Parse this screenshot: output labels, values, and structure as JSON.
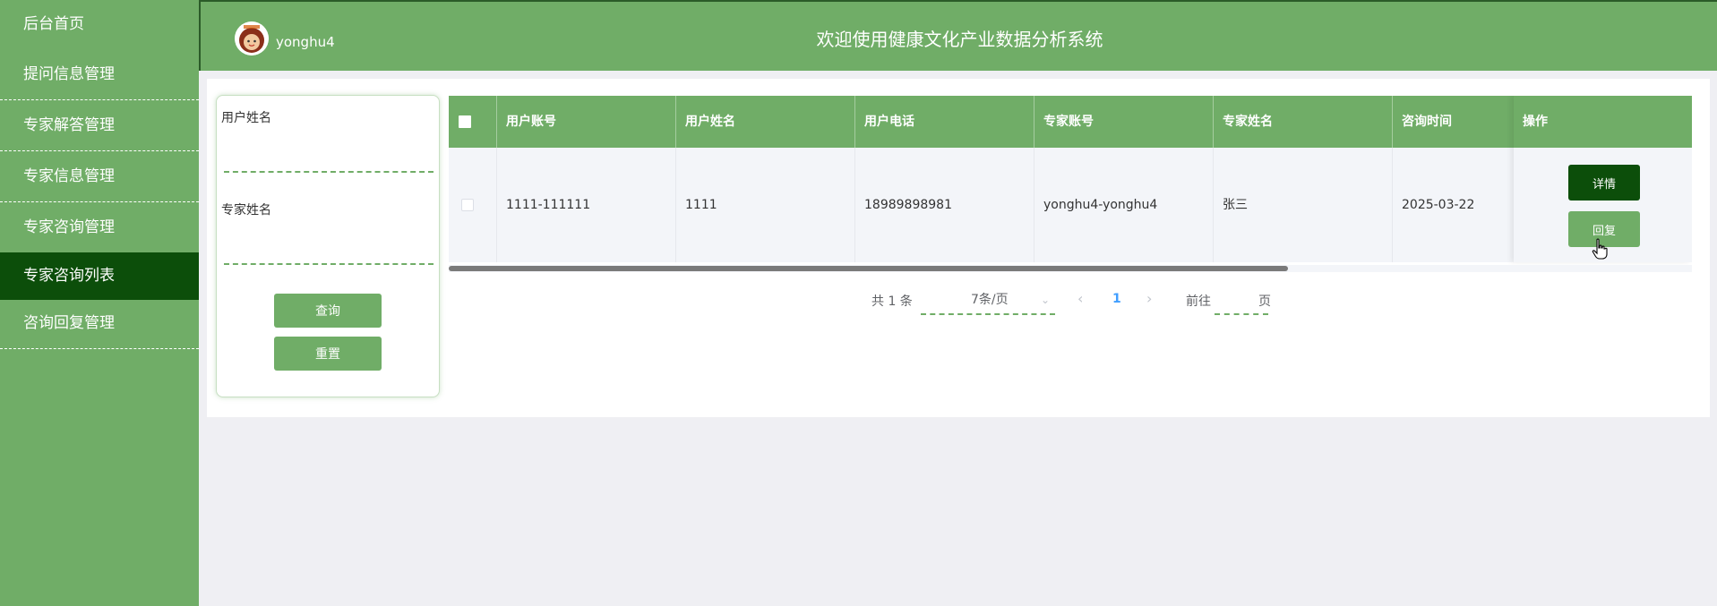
{
  "sidebar": {
    "items": [
      {
        "label": "后台首页"
      },
      {
        "label": "提问信息管理"
      },
      {
        "label": "专家解答管理"
      },
      {
        "label": "专家信息管理"
      },
      {
        "label": "专家咨询管理"
      },
      {
        "label": "专家咨询列表"
      },
      {
        "label": "咨询回复管理"
      }
    ],
    "active_index": 5
  },
  "header": {
    "username": "yonghu4",
    "title": "欢迎使用健康文化产业数据分析系统"
  },
  "search": {
    "user_name_label": "用户姓名",
    "user_name_value": "",
    "expert_name_label": "专家姓名",
    "expert_name_value": "",
    "query_button": "查询",
    "reset_button": "重置"
  },
  "table": {
    "columns": [
      "用户账号",
      "用户姓名",
      "用户电话",
      "专家账号",
      "专家姓名",
      "咨询时间",
      "操作"
    ],
    "rows": [
      {
        "user_account": "1111-111111",
        "user_name": "1111",
        "user_phone": "18989898981",
        "expert_account": "yonghu4-yonghu4",
        "expert_name": "张三",
        "consult_time": "2025-03-22"
      }
    ],
    "detail_button": "详情",
    "reply_button": "回复"
  },
  "pagination": {
    "total": "共 1 条",
    "page_size": "7条/页",
    "current_page": "1",
    "goto_label": "前往",
    "goto_suffix": "页",
    "goto_value": ""
  },
  "colors": {
    "primary": "#70ad67",
    "active": "#0c4e0a",
    "page_link": "#409eff"
  }
}
